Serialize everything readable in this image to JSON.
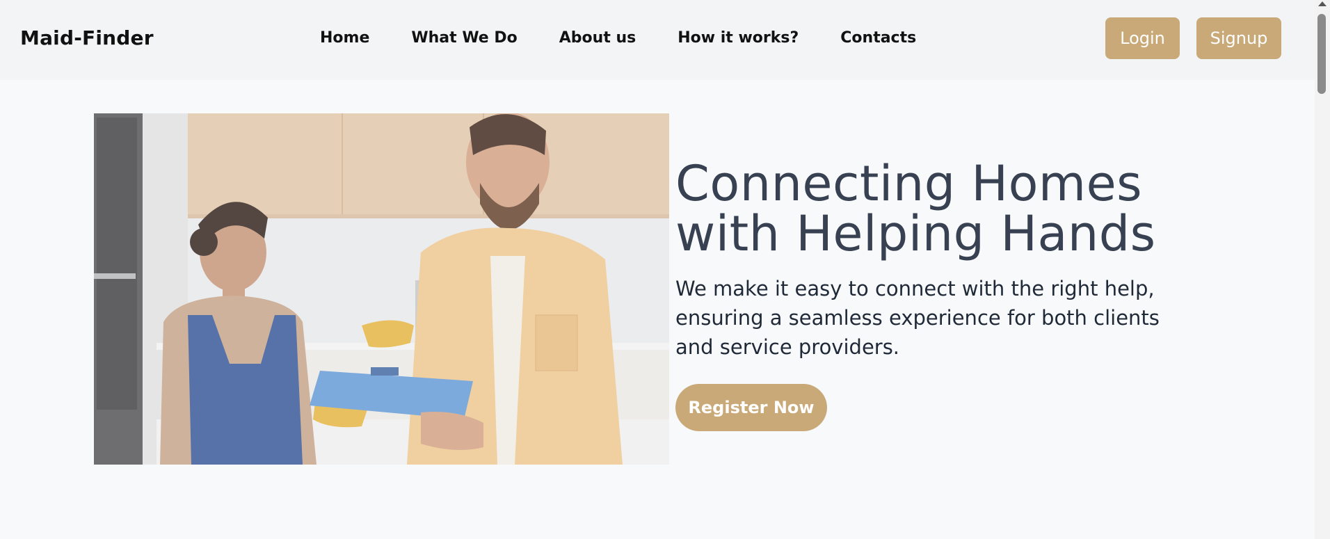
{
  "header": {
    "brand": "Maid-Finder",
    "nav": [
      {
        "label": "Home"
      },
      {
        "label": "What We Do"
      },
      {
        "label": "About us"
      },
      {
        "label": "How it works?"
      },
      {
        "label": "Contacts"
      }
    ],
    "login_label": "Login",
    "signup_label": "Signup"
  },
  "hero": {
    "title_line1": "Connecting Homes",
    "title_line2": "with Helping Hands",
    "description": "We make it easy to connect with the right help, ensuring a seamless experience for both clients and service providers.",
    "cta_label": "Register Now"
  },
  "colors": {
    "accent": "#c9a977",
    "heading": "#374151",
    "nav_bg": "#f3f4f6",
    "page_bg": "#f8f9fb"
  },
  "icons": {
    "scroll_up": "scroll-up-arrow-icon"
  }
}
